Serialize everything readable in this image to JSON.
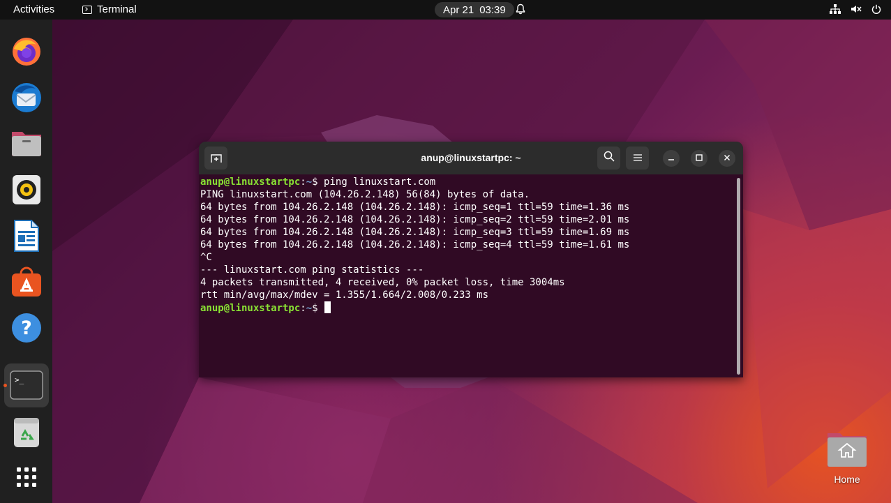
{
  "topbar": {
    "activities": "Activities",
    "app_name": "Terminal",
    "date": "Apr 21",
    "time": "03:39"
  },
  "dock": {
    "items": [
      {
        "name": "firefox-icon"
      },
      {
        "name": "thunderbird-icon"
      },
      {
        "name": "files-icon"
      },
      {
        "name": "rhythmbox-icon"
      },
      {
        "name": "libreoffice-writer-icon"
      },
      {
        "name": "ubuntu-software-icon"
      },
      {
        "name": "help-icon"
      },
      {
        "name": "terminal-icon"
      },
      {
        "name": "trash-icon"
      },
      {
        "name": "show-apps-icon"
      }
    ],
    "help_glyph": "?",
    "terminal_prompt_glyph": ">_"
  },
  "terminal": {
    "title": "anup@linuxstartpc: ~",
    "prompt_user": "anup@linuxstartpc",
    "prompt_sep": ":",
    "prompt_path": "~",
    "prompt_symbol": "$ ",
    "command": "ping linuxstart.com",
    "output": [
      "PING linuxstart.com (104.26.2.148) 56(84) bytes of data.",
      "64 bytes from 104.26.2.148 (104.26.2.148): icmp_seq=1 ttl=59 time=1.36 ms",
      "64 bytes from 104.26.2.148 (104.26.2.148): icmp_seq=2 ttl=59 time=2.01 ms",
      "64 bytes from 104.26.2.148 (104.26.2.148): icmp_seq=3 ttl=59 time=1.69 ms",
      "64 bytes from 104.26.2.148 (104.26.2.148): icmp_seq=4 ttl=59 time=1.61 ms",
      "^C",
      "--- linuxstart.com ping statistics ---",
      "4 packets transmitted, 4 received, 0% packet loss, time 3004ms",
      "rtt min/avg/max/mdev = 1.355/1.664/2.008/0.233 ms"
    ]
  },
  "desktop": {
    "home_label": "Home"
  },
  "colors": {
    "terminal_bg": "#300a24",
    "prompt_user": "#8ae234",
    "prompt_path": "#729fcf",
    "accent": "#e95420"
  }
}
